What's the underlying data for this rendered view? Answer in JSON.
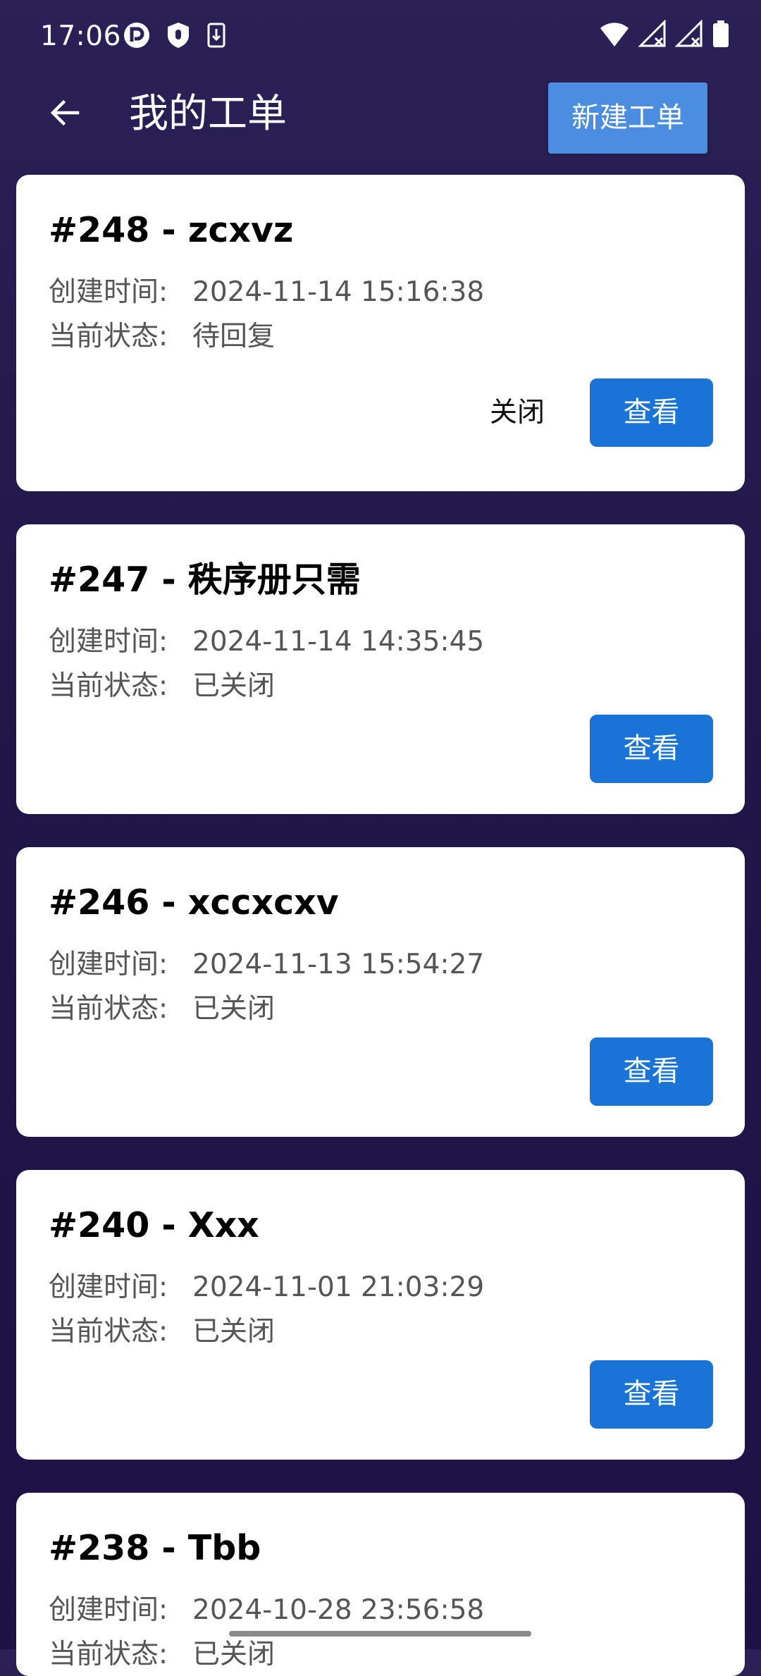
{
  "status_bar": {
    "time": "17:06",
    "left_icons": [
      "pinwheel-icon",
      "location-shield-icon",
      "download-icon"
    ],
    "right_icons": [
      "wifi-icon",
      "signal-no-service-icon",
      "signal-no-service-icon",
      "battery-icon"
    ]
  },
  "app_bar": {
    "title": "我的工单",
    "new_ticket_label": "新建工单"
  },
  "labels": {
    "created": "创建时间:",
    "status": "当前状态:",
    "close": "关闭",
    "view": "查看"
  },
  "tickets": [
    {
      "title": "#248 - zcxvz",
      "created": "2024-11-14 15:16:38",
      "status": "待回复",
      "closable": true
    },
    {
      "title": "#247 - 秩序册只需",
      "created": "2024-11-14 14:35:45",
      "status": "已关闭",
      "closable": false
    },
    {
      "title": "#246 - xccxcxv",
      "created": "2024-11-13 15:54:27",
      "status": "已关闭",
      "closable": false
    },
    {
      "title": "#240 - Xxx",
      "created": "2024-11-01 21:03:29",
      "status": "已关闭",
      "closable": false
    },
    {
      "title": "#238 - Tbb",
      "created": "2024-10-28 23:56:58",
      "status": "已关闭",
      "closable": false
    }
  ],
  "colors": {
    "background": "#231850",
    "new_ticket_button": "#4b8de0",
    "view_button": "#1a73d6",
    "card": "#ffffff"
  }
}
